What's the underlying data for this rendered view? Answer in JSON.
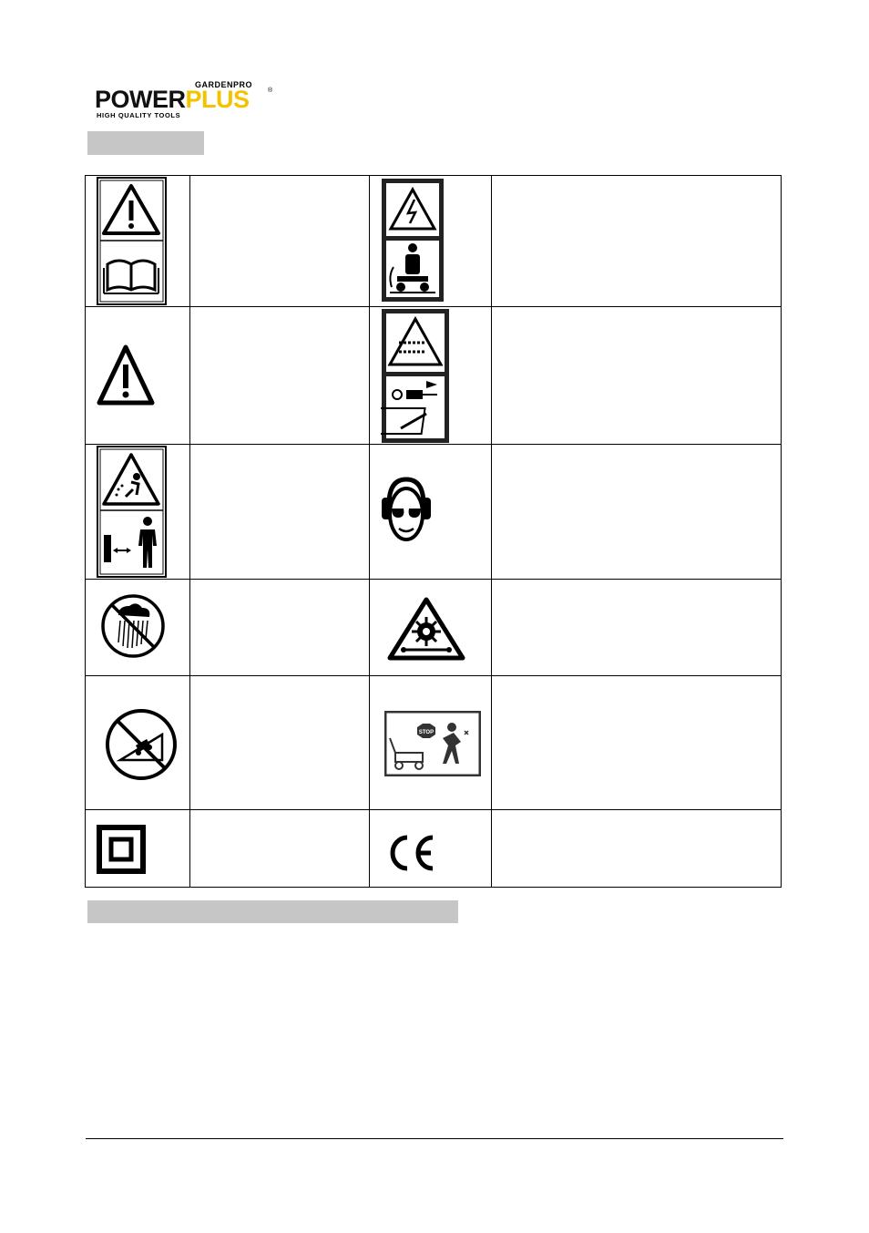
{
  "logo": {
    "top_text": "GARDENPRO",
    "brand_part1": "POWER",
    "brand_part2": "PLUS",
    "registered": "®",
    "tagline": "HIGH QUALITY TOOLS"
  },
  "colors": {
    "brand_yellow": "#f3c300",
    "section_bar": "#c6c6c6",
    "ink": "#000000"
  },
  "symbols": [
    {
      "icon": "warning-read-manual-icon",
      "text": ""
    },
    {
      "icon": "electric-shock-warning-icon",
      "text": ""
    },
    {
      "icon": "warning-triangle-icon",
      "text": ""
    },
    {
      "icon": "disconnect-plug-before-maintenance-icon",
      "text": ""
    },
    {
      "icon": "thrown-objects-keep-distance-icon",
      "text": ""
    },
    {
      "icon": "wear-ear-eye-protection-icon",
      "text": ""
    },
    {
      "icon": "no-rain-icon",
      "text": ""
    },
    {
      "icon": "rotating-blade-warning-icon",
      "text": ""
    },
    {
      "icon": "no-slope-mowing-icon",
      "text": ""
    },
    {
      "icon": "stop-before-clearing-icon",
      "text": ""
    },
    {
      "icon": "double-insulation-icon",
      "text": ""
    },
    {
      "icon": "ce-mark-icon",
      "text": "CE"
    }
  ]
}
